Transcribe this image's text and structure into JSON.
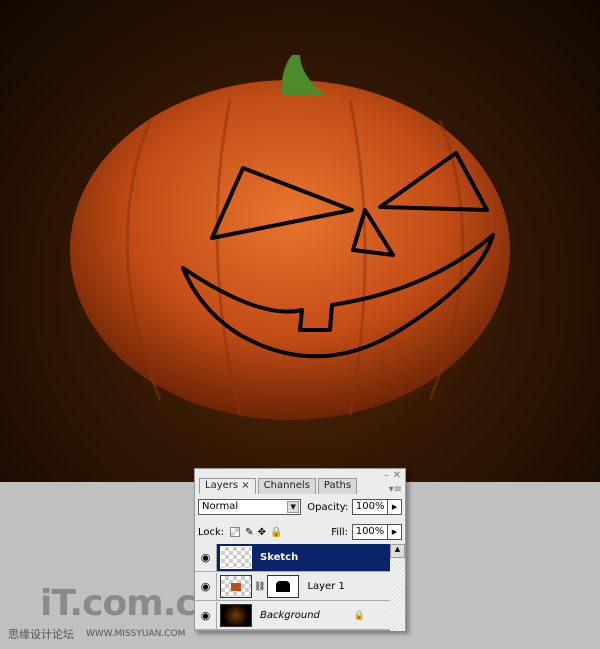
{
  "panel": {
    "tabs": [
      {
        "label": "Layers ×"
      },
      {
        "label": "Channels"
      },
      {
        "label": "Paths"
      }
    ],
    "blend_mode": "Normal",
    "opacity_label": "Opacity:",
    "opacity": "100%",
    "lock_label": "Lock:",
    "fill_label": "Fill:",
    "fill": "100%",
    "layers": [
      {
        "name": "Sketch",
        "selected": true,
        "visible": true
      },
      {
        "name": "Layer 1",
        "selected": false,
        "visible": true
      },
      {
        "name": "Background",
        "selected": false,
        "visible": true,
        "locked": true
      }
    ]
  },
  "watermark": {
    "logo": "iT.com.cn",
    "site_cn": "思缘设计论坛",
    "site_url": "WWW.MISSYUAN.COM"
  },
  "colors": {
    "selected": "#0a246a",
    "pumpkin": "#c8501a",
    "background_top": "#120801",
    "workspace": "#c0c0c0"
  }
}
